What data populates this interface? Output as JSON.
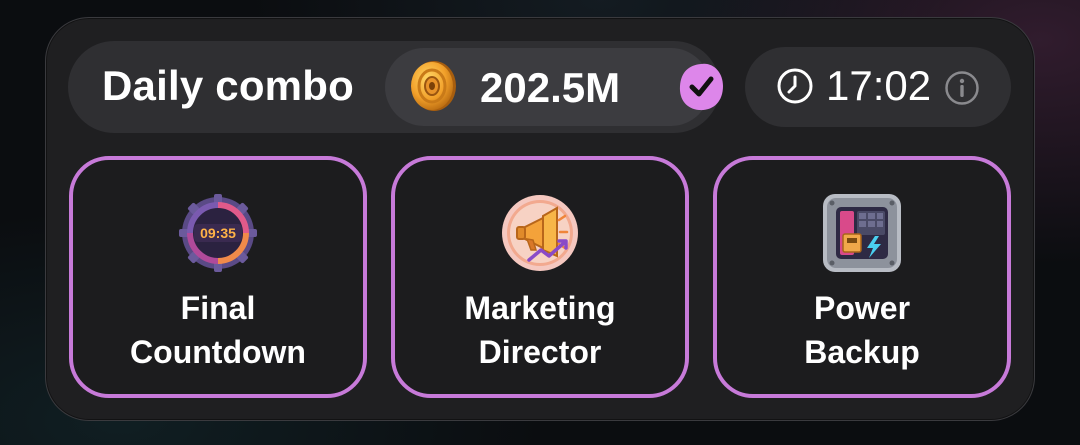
{
  "header": {
    "title": "Daily combo",
    "reward_value": "202.5M",
    "timer_value": "17:02",
    "icons": {
      "coin": "coin-icon",
      "completed": "checkmark-badge-icon",
      "clock": "clock-icon",
      "info": "info-icon"
    }
  },
  "cards": [
    {
      "label_line1": "Final",
      "label_line2": "Countdown",
      "icon": "countdown-timer-icon",
      "icon_text": "09:35"
    },
    {
      "label_line1": "Marketing",
      "label_line2": "Director",
      "icon": "megaphone-icon"
    },
    {
      "label_line1": "Power",
      "label_line2": "Backup",
      "icon": "power-backup-device-icon"
    }
  ],
  "colors": {
    "accent": "#c77ad9",
    "card_background": "#1f1f21",
    "pill_background": "#2f2f32",
    "coin_gold": "#f2a02a"
  }
}
